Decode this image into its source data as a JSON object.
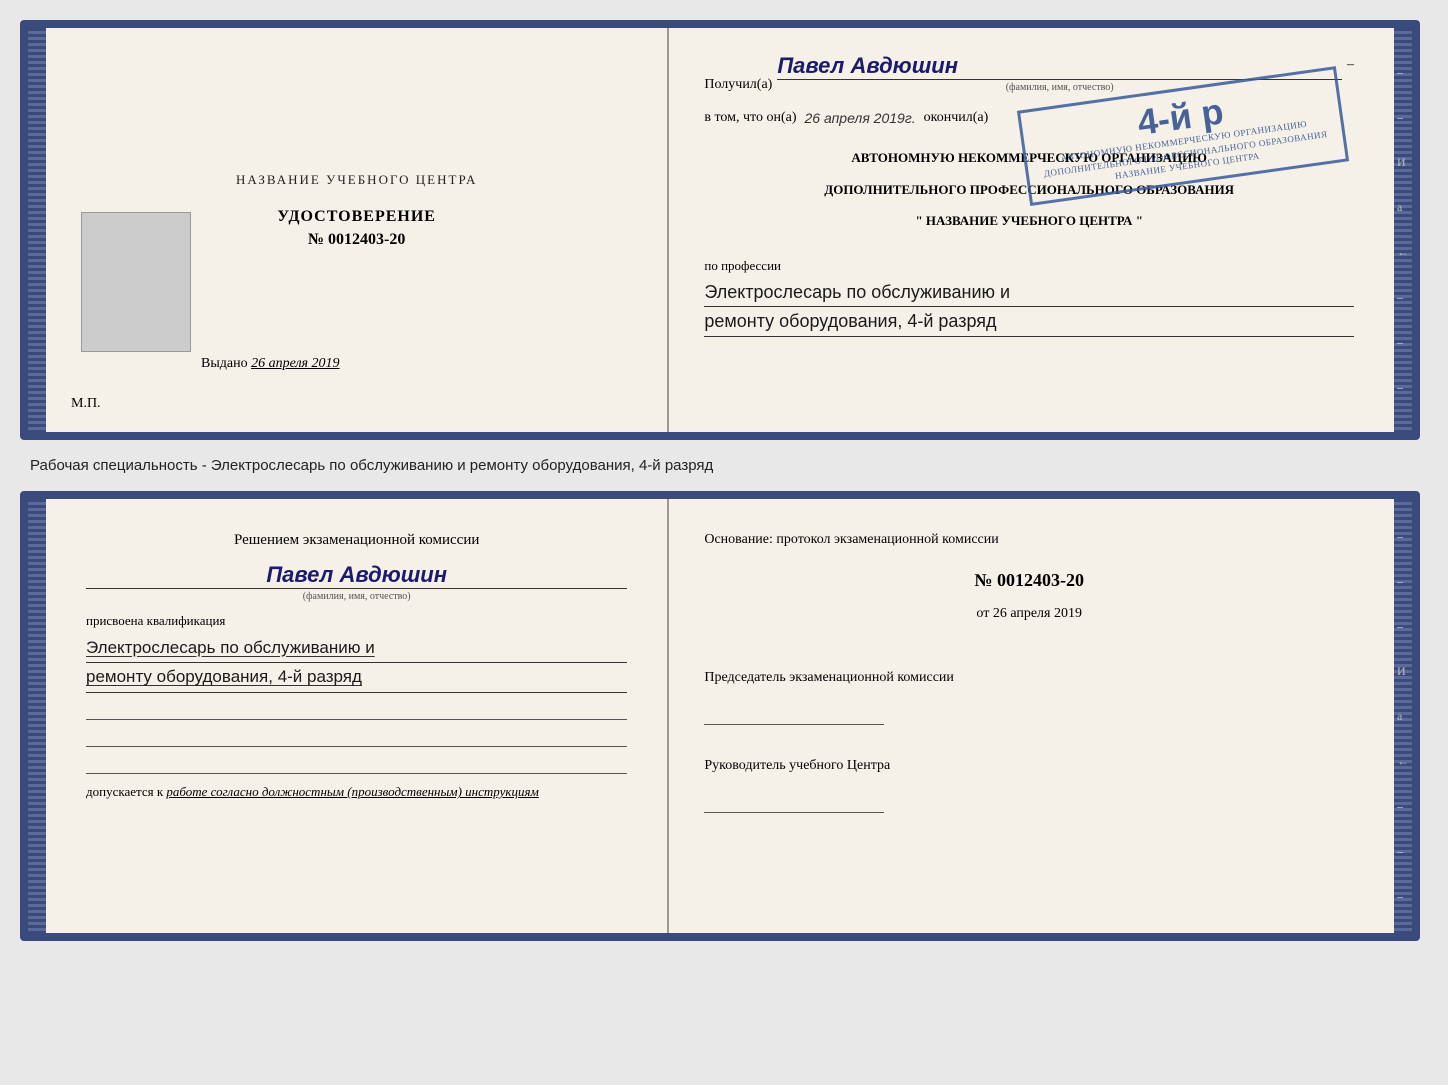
{
  "top_doc": {
    "left": {
      "title": "НАЗВАНИЕ УЧЕБНОГО ЦЕНТРА",
      "cert_label": "УДОСТОВЕРЕНИЕ",
      "cert_number": "№ 0012403-20",
      "issued_label": "Выдано",
      "issued_date": "26 апреля 2019",
      "mp_label": "М.П."
    },
    "right": {
      "received_label": "Получил(а)",
      "recipient_name": "Павел Авдюшин",
      "fio_label": "(фамилия, имя, отчество)",
      "in_that_label": "в том, что он(а)",
      "date_handwritten": "26 апреля 2019г.",
      "finished_label": "окончил(а)",
      "org_line1": "АВТОНОМНУЮ НЕКОММЕРЧЕСКУЮ ОРГАНИЗАЦИЮ",
      "org_line2": "ДОПОЛНИТЕЛЬНОГО ПРОФЕССИОНАЛЬНОГО ОБРАЗОВАНИЯ",
      "org_line3": "\" НАЗВАНИЕ УЧЕБНОГО ЦЕНТРА \"",
      "profession_label": "по профессии",
      "profession_line1": "Электрослесарь по обслуживанию и",
      "profession_line2": "ремонту оборудования, 4-й разряд",
      "stamp_big": "4-й р",
      "stamp_line1": "АВТОНОМНУЮ НЕКОММЕРЧЕСКУЮ",
      "stamp_line2": "ОРГАНИЗАЦИЮ ДОПОЛНИТЕЛЬНОГО",
      "stamp_line3": "ПРОФЕССИОНАЛЬНОГО ОБРАЗОВАНИЯ",
      "stamp_line4": "НАЗВАНИЕ УЧЕБНОГО ЦЕНТРА"
    }
  },
  "middle_text": "Рабочая специальность - Электрослесарь по обслуживанию и ремонту оборудования, 4-й разряд",
  "bottom_doc": {
    "left": {
      "decision_title": "Решением экзаменационной комиссии",
      "person_name": "Павел Авдюшин",
      "fio_label": "(фамилия, имя, отчество)",
      "qualification_label": "присвоена квалификация",
      "qual_line1": "Электрослесарь по обслуживанию и",
      "qual_line2": "ремонту оборудования, 4-й разряд",
      "allowed_label": "допускается к",
      "allowed_italic": "работе согласно должностным (производственным) инструкциям"
    },
    "right": {
      "basis_label": "Основание: протокол экзаменационной комиссии",
      "protocol_number": "№ 0012403-20",
      "date_prefix": "от",
      "protocol_date": "26 апреля 2019",
      "chairman_label": "Председатель экзаменационной комиссии",
      "director_label": "Руководитель учебного Центра"
    }
  },
  "spine_chars": [
    "И",
    "а",
    "←"
  ]
}
